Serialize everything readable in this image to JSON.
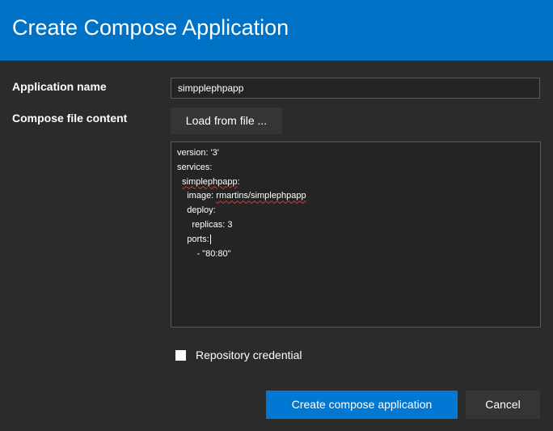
{
  "dialog": {
    "title": "Create Compose Application",
    "accent_color": "#0072c6",
    "background_color": "#2b2b2b"
  },
  "form": {
    "app_name_label": "Application name",
    "app_name_value": "simpplephpapp",
    "compose_label": "Compose file content",
    "load_button_label": "Load from file ...",
    "compose_lines": [
      "version: '3'",
      "services:",
      "  simplephpapp:",
      "    image: rmartins/simplephpapp",
      "    deploy:",
      "      replicas: 3",
      "    ports:",
      "        - \"80:80\""
    ],
    "repo_credential_label": "Repository credential",
    "repo_credential_checked": false
  },
  "actions": {
    "create_label": "Create compose application",
    "cancel_label": "Cancel",
    "primary_color": "#0078d4"
  }
}
